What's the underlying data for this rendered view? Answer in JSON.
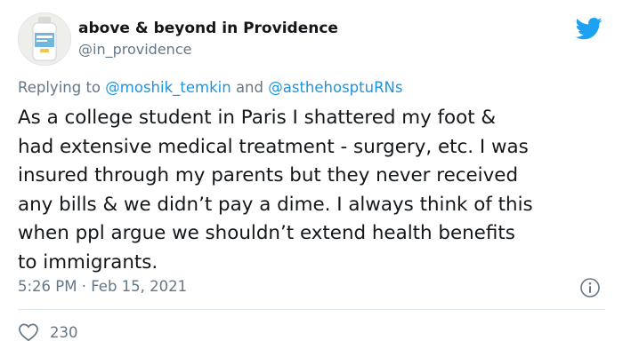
{
  "author": {
    "display_name": "above & beyond in Providence",
    "handle": "@in_providence",
    "avatar_icon": "hand-sanitizer-bottle-avatar"
  },
  "brand_icon": "twitter-bird-icon",
  "reply": {
    "prefix": "Replying to",
    "mention_1": "@moshik_temkin",
    "conjunction": "and",
    "mention_2": "@asthehosptuRNs"
  },
  "tweet": {
    "lines": [
      "As a college student in Paris I shattered my foot &",
      "had extensive medical treatment - surgery, etc. I was",
      "insured through my parents but they never received",
      "any bills & we didn’t pay a dime. I always think of this",
      "when ppl argue we shouldn’t extend health benefits",
      "to immigrants."
    ]
  },
  "timestamp": "5:26 PM · Feb 15, 2021",
  "likes": {
    "count": "230",
    "icon": "heart-icon"
  },
  "info_icon": "info-icon",
  "colors": {
    "twitter_blue": "#1da1f2",
    "mention": "#1b95e0",
    "muted": "#657786",
    "text": "#14171a"
  }
}
